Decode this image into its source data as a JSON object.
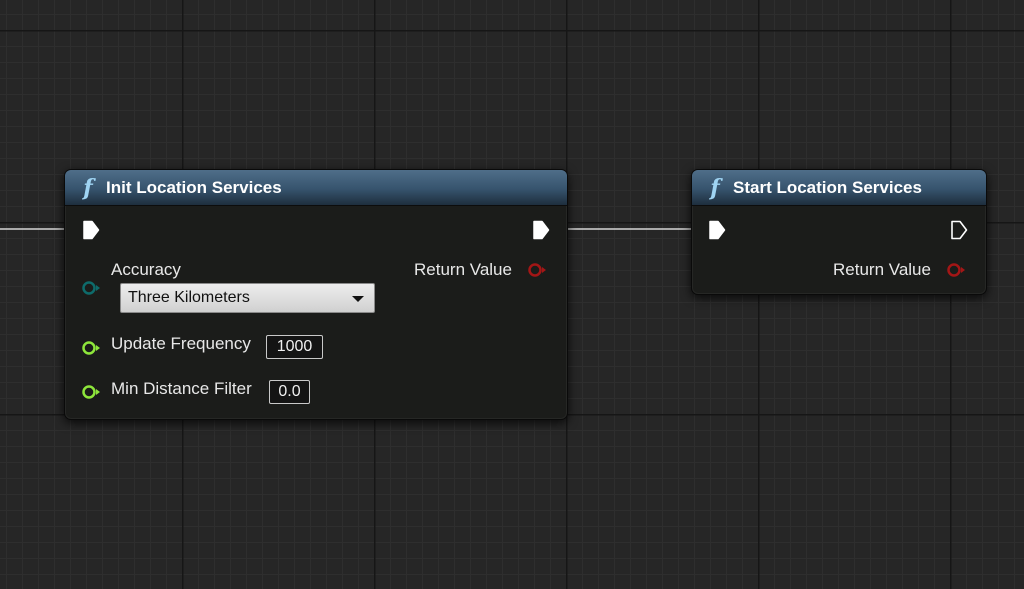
{
  "nodes": {
    "init": {
      "title": "Init Location Services",
      "accuracy_label": "Accuracy",
      "accuracy_value": "Three Kilometers",
      "return_label": "Return Value",
      "update_frequency_label": "Update Frequency",
      "update_frequency_value": "1000",
      "min_distance_label": "Min Distance Filter",
      "min_distance_value": "0.0"
    },
    "start": {
      "title": "Start Location Services",
      "return_label": "Return Value"
    }
  },
  "colors": {
    "header_blue": "#36536d",
    "function_icon": "#9fd4f3",
    "byte_enum_pin": "#0e6b6b",
    "integer_float_pin": "#8ee63b",
    "bool_return_pin": "#a31616",
    "exec_pin": "#ffffff"
  },
  "icons": {
    "function": "function-f-icon",
    "exec": "exec-arrow-icon",
    "dropdown": "chevron-down-icon"
  }
}
